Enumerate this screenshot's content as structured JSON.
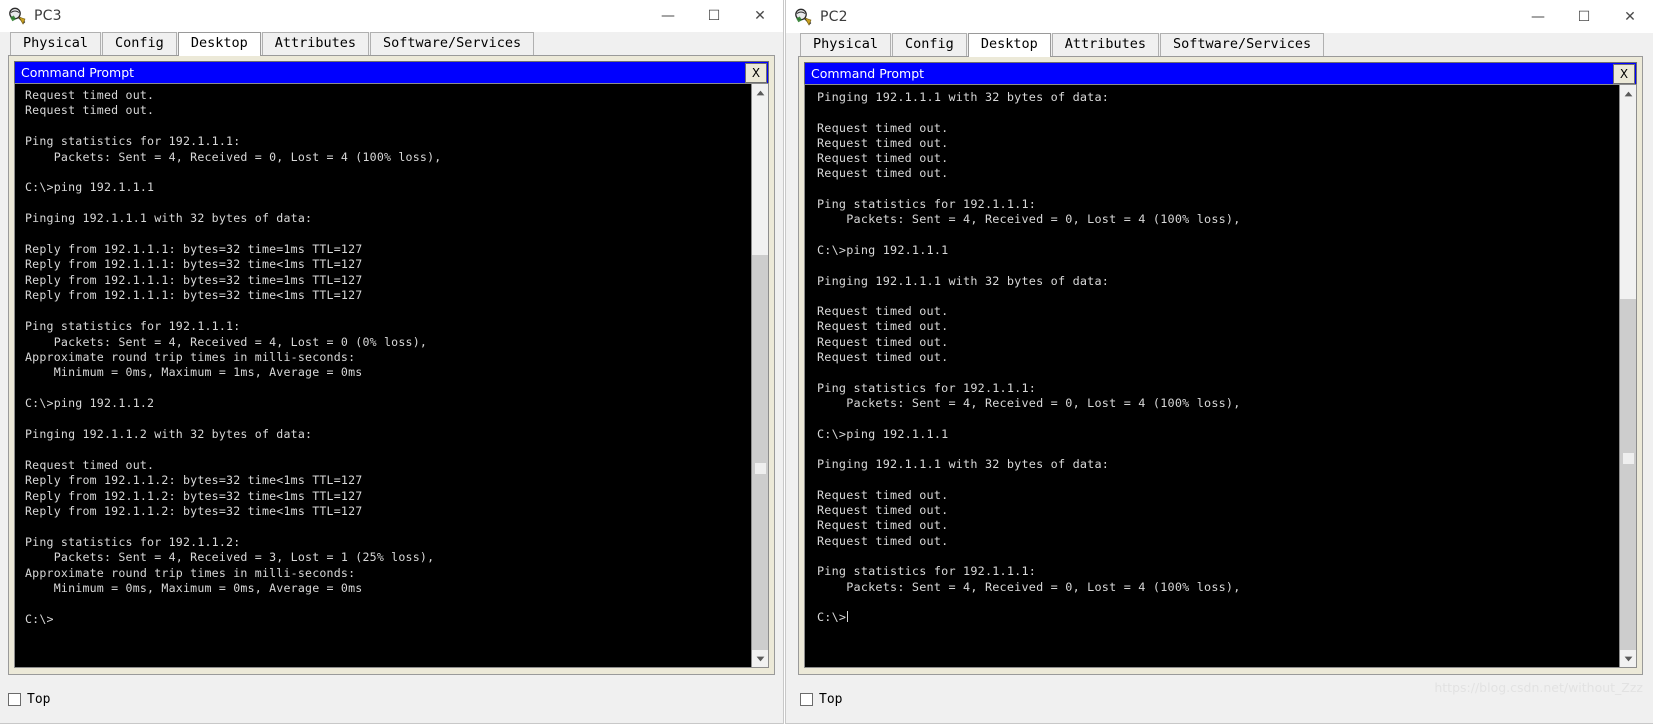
{
  "windows": [
    {
      "id": "pc3",
      "title": "PC3",
      "icon": "packet-tracer-pc-icon",
      "controls": {
        "minimize": "—",
        "maximize": "☐",
        "close": "✕"
      },
      "tabs": [
        {
          "label": "Physical",
          "active": false
        },
        {
          "label": "Config",
          "active": false
        },
        {
          "label": "Desktop",
          "active": true
        },
        {
          "label": "Attributes",
          "active": false
        },
        {
          "label": "Software/Services",
          "active": false
        }
      ],
      "cmd": {
        "title": "Command Prompt",
        "close_label": "X",
        "terminal_text": "Request timed out.\nRequest timed out.\n\nPing statistics for 192.1.1.1:\n    Packets: Sent = 4, Received = 0, Lost = 4 (100% loss),\n\nC:\\>ping 192.1.1.1\n\nPinging 192.1.1.1 with 32 bytes of data:\n\nReply from 192.1.1.1: bytes=32 time=1ms TTL=127\nReply from 192.1.1.1: bytes=32 time<1ms TTL=127\nReply from 192.1.1.1: bytes=32 time=1ms TTL=127\nReply from 192.1.1.1: bytes=32 time<1ms TTL=127\n\nPing statistics for 192.1.1.1:\n    Packets: Sent = 4, Received = 4, Lost = 0 (0% loss),\nApproximate round trip times in milli-seconds:\n    Minimum = 0ms, Maximum = 1ms, Average = 0ms\n\nC:\\>ping 192.1.1.2\n\nPinging 192.1.1.2 with 32 bytes of data:\n\nRequest timed out.\nReply from 192.1.1.2: bytes=32 time<1ms TTL=127\nReply from 192.1.1.2: bytes=32 time<1ms TTL=127\nReply from 192.1.1.2: bytes=32 time<1ms TTL=127\n\nPing statistics for 192.1.1.2:\n    Packets: Sent = 4, Received = 3, Lost = 1 (25% loss),\nApproximate round trip times in milli-seconds:\n    Minimum = 0ms, Maximum = 0ms, Average = 0ms\n\nC:\\>",
        "cursor_visible": false
      },
      "scrollbar": {
        "thumb_top_pct": 28,
        "thumb_height_pct": 72,
        "mark_top_pct": 66
      },
      "footer": {
        "checkbox_label": "Top",
        "checked": false
      }
    },
    {
      "id": "pc2",
      "title": "PC2",
      "icon": "packet-tracer-pc-icon",
      "controls": {
        "minimize": "—",
        "maximize": "☐",
        "close": "✕"
      },
      "tabs": [
        {
          "label": "Physical",
          "active": false
        },
        {
          "label": "Config",
          "active": false
        },
        {
          "label": "Desktop",
          "active": true
        },
        {
          "label": "Attributes",
          "active": false
        },
        {
          "label": "Software/Services",
          "active": false
        }
      ],
      "cmd": {
        "title": "Command Prompt",
        "close_label": "X",
        "terminal_text": "Pinging 192.1.1.1 with 32 bytes of data:\n\nRequest timed out.\nRequest timed out.\nRequest timed out.\nRequest timed out.\n\nPing statistics for 192.1.1.1:\n    Packets: Sent = 4, Received = 0, Lost = 4 (100% loss),\n\nC:\\>ping 192.1.1.1\n\nPinging 192.1.1.1 with 32 bytes of data:\n\nRequest timed out.\nRequest timed out.\nRequest timed out.\nRequest timed out.\n\nPing statistics for 192.1.1.1:\n    Packets: Sent = 4, Received = 0, Lost = 4 (100% loss),\n\nC:\\>ping 192.1.1.1\n\nPinging 192.1.1.1 with 32 bytes of data:\n\nRequest timed out.\nRequest timed out.\nRequest timed out.\nRequest timed out.\n\nPing statistics for 192.1.1.1:\n    Packets: Sent = 4, Received = 0, Lost = 4 (100% loss),\n\nC:\\>",
        "cursor_visible": true
      },
      "scrollbar": {
        "thumb_top_pct": 36,
        "thumb_height_pct": 64,
        "mark_top_pct": 64
      },
      "footer": {
        "checkbox_label": "Top",
        "checked": false
      }
    }
  ],
  "watermark": "https://blog.csdn.net/without_Zzz",
  "colors": {
    "cmd_titlebar": "#0000ff",
    "terminal_bg": "#000000",
    "terminal_fg": "#d8d8d8",
    "panel_bg": "#ece9d8",
    "window_chrome": "#f0f0f0"
  }
}
